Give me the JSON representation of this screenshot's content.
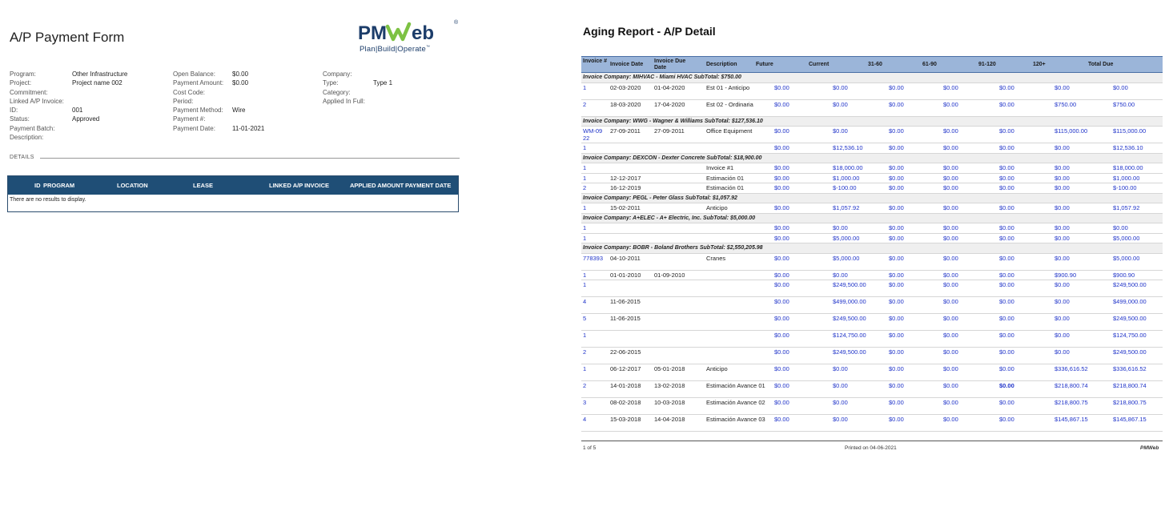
{
  "form": {
    "title": "A/P Payment Form",
    "logo": {
      "word": "PMWeb",
      "registered": "®",
      "tagline": "Plan|Build|Operate",
      "trademark": "™",
      "colors": {
        "navy": "#1c3d6a",
        "green": "#7dc243"
      }
    },
    "fields_col1": [
      {
        "label": "Program:",
        "value": "Other Infrastructure"
      },
      {
        "label": "Project:",
        "value": "Project name 002"
      },
      {
        "label": "Commitment:",
        "value": ""
      },
      {
        "label": "Linked A/P Invoice:",
        "value": ""
      },
      {
        "label": "ID:",
        "value": "001"
      },
      {
        "label": "Status:",
        "value": "Approved"
      },
      {
        "label": "Payment Batch:",
        "value": ""
      },
      {
        "label": "Description:",
        "value": ""
      }
    ],
    "fields_col2": [
      {
        "label": "Open Balance:",
        "value": "$0.00"
      },
      {
        "label": "Payment Amount:",
        "value": "$0.00"
      },
      {
        "label": "Cost Code:",
        "value": ""
      },
      {
        "label": "Period:",
        "value": ""
      },
      {
        "label": "Payment Method:",
        "value": "Wire"
      },
      {
        "label": "Payment #:",
        "value": ""
      },
      {
        "label": "Payment Date:",
        "value": "11-01-2021"
      }
    ],
    "fields_col3": [
      {
        "label": "Company:",
        "value": ""
      },
      {
        "label": "Type:",
        "value": "Type 1"
      },
      {
        "label": "Category:",
        "value": ""
      },
      {
        "label": "Applied In Full:",
        "value": ""
      }
    ],
    "details_label": "DETAILS",
    "grid_headers": [
      "ID",
      "PROGRAM",
      "LOCATION",
      "LEASE",
      "LINKED A/P INVOICE",
      "APPLIED AMOUNT",
      "PAYMENT DATE"
    ],
    "grid_empty": "There are no results to display.",
    "grid_header_color": "#1f4e76"
  },
  "report": {
    "title": "Aging Report - A/P Detail",
    "headers": {
      "invoice": "Invoice #",
      "invoice_date": "Invoice Date",
      "invoice_due": "Invoice Due Date",
      "description": "Description",
      "future": "Future",
      "current": "Current",
      "d31": "31-60",
      "d61": "61-90",
      "d91": "91-120",
      "d120": "120+",
      "total": "Total Due"
    },
    "header_color": "#9bb5d9",
    "link_color": "#1f33c9",
    "groups": [
      {
        "title": "Invoice Company: MIHVAC - Miami HVAC   SubTotal: $750.00",
        "rows": [
          {
            "inv": "1",
            "idate": "02-03-2020",
            "ddate": "01-04-2020",
            "desc": "Est 01 - Anticipo",
            "fut": "$0.00",
            "cur": "$0.00",
            "d31": "$0.00",
            "d61": "$0.00",
            "d91": "$0.00",
            "d120": "$0.00",
            "tot": "$0.00"
          },
          {
            "inv": "2",
            "idate": "18-03-2020",
            "ddate": "17-04-2020",
            "desc": "Est 02 - Ordinaria",
            "fut": "$0.00",
            "cur": "$0.00",
            "d31": "$0.00",
            "d61": "$0.00",
            "d91": "$0.00",
            "d120": "$750.00",
            "tot": "$750.00"
          }
        ]
      },
      {
        "title": "Invoice Company: WWG - Wagner & Williams   SubTotal: $127,536.10",
        "rows": [
          {
            "inv": "WM-0922",
            "idate": "27-09-2011",
            "ddate": "27-09-2011",
            "desc": "Office Equipment",
            "fut": "$0.00",
            "cur": "$0.00",
            "d31": "$0.00",
            "d61": "$0.00",
            "d91": "$0.00",
            "d120": "$115,000.00",
            "tot": "$115,000.00"
          },
          {
            "inv": "1",
            "idate": "",
            "ddate": "",
            "desc": "",
            "fut": "$0.00",
            "cur": "$12,536.10",
            "d31": "$0.00",
            "d61": "$0.00",
            "d91": "$0.00",
            "d120": "$0.00",
            "tot": "$12,536.10"
          }
        ]
      },
      {
        "title": "Invoice Company: DEXCON - Dexter Concrete   SubTotal: $18,900.00",
        "rows": [
          {
            "inv": "1",
            "idate": "",
            "ddate": "",
            "desc": "Invoice #1",
            "fut": "$0.00",
            "cur": "$18,000.00",
            "d31": "$0.00",
            "d61": "$0.00",
            "d91": "$0.00",
            "d120": "$0.00",
            "tot": "$18,000.00"
          },
          {
            "inv": "1",
            "idate": "12-12-2017",
            "ddate": "",
            "desc": "Estimación 01",
            "fut": "$0.00",
            "cur": "$1,000.00",
            "d31": "$0.00",
            "d61": "$0.00",
            "d91": "$0.00",
            "d120": "$0.00",
            "tot": "$1,000.00"
          },
          {
            "inv": "2",
            "idate": "16-12-2019",
            "ddate": "",
            "desc": "Estimación 01",
            "fut": "$0.00",
            "cur": "$-100.00",
            "d31": "$0.00",
            "d61": "$0.00",
            "d91": "$0.00",
            "d120": "$0.00",
            "tot": "$-100.00"
          }
        ]
      },
      {
        "title": "Invoice Company: PEGL - Peter Glass   SubTotal: $1,057.92",
        "rows": [
          {
            "inv": "1",
            "idate": "15-02-2011",
            "ddate": "",
            "desc": "Anticipo",
            "fut": "$0.00",
            "cur": "$1,057.92",
            "d31": "$0.00",
            "d61": "$0.00",
            "d91": "$0.00",
            "d120": "$0.00",
            "tot": "$1,057.92"
          }
        ]
      },
      {
        "title": "Invoice Company: A+ELEC - A+ Electric, Inc.   SubTotal: $5,000.00",
        "rows": [
          {
            "inv": "1",
            "idate": "",
            "ddate": "",
            "desc": "",
            "fut": "$0.00",
            "cur": "$0.00",
            "d31": "$0.00",
            "d61": "$0.00",
            "d91": "$0.00",
            "d120": "$0.00",
            "tot": "$0.00"
          },
          {
            "inv": "1",
            "idate": "",
            "ddate": "",
            "desc": "",
            "fut": "$0.00",
            "cur": "$5,000.00",
            "d31": "$0.00",
            "d61": "$0.00",
            "d91": "$0.00",
            "d120": "$0.00",
            "tot": "$5,000.00"
          }
        ]
      },
      {
        "title": "Invoice Company: BOBR - Boland Brothers   SubTotal: $2,550,205.98",
        "rows": [
          {
            "inv": "778393",
            "idate": "04-10-2011",
            "ddate": "",
            "desc": "Cranes",
            "fut": "$0.00",
            "cur": "$5,000.00",
            "d31": "$0.00",
            "d61": "$0.00",
            "d91": "$0.00",
            "d120": "$0.00",
            "tot": "$5,000.00"
          },
          {
            "inv": "1",
            "idate": "01-01-2010",
            "ddate": "01-09-2010",
            "desc": "",
            "fut": "$0.00",
            "cur": "$0.00",
            "d31": "$0.00",
            "d61": "$0.00",
            "d91": "$0.00",
            "d120": "$900.90",
            "tot": "$900.90"
          },
          {
            "inv": "1",
            "idate": "",
            "ddate": "",
            "desc": "",
            "fut": "$0.00",
            "cur": "$249,500.00",
            "d31": "$0.00",
            "d61": "$0.00",
            "d91": "$0.00",
            "d120": "$0.00",
            "tot": "$249,500.00"
          },
          {
            "inv": "4",
            "idate": "11-06-2015",
            "ddate": "",
            "desc": "",
            "fut": "$0.00",
            "cur": "$499,000.00",
            "d31": "$0.00",
            "d61": "$0.00",
            "d91": "$0.00",
            "d120": "$0.00",
            "tot": "$499,000.00"
          },
          {
            "inv": "5",
            "idate": "11-06-2015",
            "ddate": "",
            "desc": "",
            "fut": "$0.00",
            "cur": "$249,500.00",
            "d31": "$0.00",
            "d61": "$0.00",
            "d91": "$0.00",
            "d120": "$0.00",
            "tot": "$249,500.00"
          },
          {
            "inv": "1",
            "idate": "",
            "ddate": "",
            "desc": "",
            "fut": "$0.00",
            "cur": "$124,750.00",
            "d31": "$0.00",
            "d61": "$0.00",
            "d91": "$0.00",
            "d120": "$0.00",
            "tot": "$124,750.00"
          },
          {
            "inv": "2",
            "idate": "22-06-2015",
            "ddate": "",
            "desc": "",
            "fut": "$0.00",
            "cur": "$249,500.00",
            "d31": "$0.00",
            "d61": "$0.00",
            "d91": "$0.00",
            "d120": "$0.00",
            "tot": "$249,500.00"
          },
          {
            "inv": "1",
            "idate": "06-12-2017",
            "ddate": "05-01-2018",
            "desc": "Anticipo",
            "fut": "$0.00",
            "cur": "$0.00",
            "d31": "$0.00",
            "d61": "$0.00",
            "d91": "$0.00",
            "d120": "$336,616.52",
            "tot": "$336,616.52"
          },
          {
            "inv": "2",
            "idate": "14-01-2018",
            "ddate": "13-02-2018",
            "desc": "Estimación Avance 01",
            "fut": "$0.00",
            "cur": "$0.00",
            "d31": "$0.00",
            "d61": "$0.00",
            "d91": "$0.00",
            "d120": "$218,800.74",
            "tot": "$218,800.74",
            "bold91": true
          },
          {
            "inv": "3",
            "idate": "08-02-2018",
            "ddate": "10-03-2018",
            "desc": "Estimación Avance 02",
            "fut": "$0.00",
            "cur": "$0.00",
            "d31": "$0.00",
            "d61": "$0.00",
            "d91": "$0.00",
            "d120": "$218,800.75",
            "tot": "$218,800.75"
          },
          {
            "inv": "4",
            "idate": "15-03-2018",
            "ddate": "14-04-2018",
            "desc": "Estimación Avance 03",
            "fut": "$0.00",
            "cur": "$0.00",
            "d31": "$0.00",
            "d61": "$0.00",
            "d91": "$0.00",
            "d120": "$145,867.15",
            "tot": "$145,867.15"
          }
        ]
      }
    ],
    "footer": {
      "page": "1 of 5",
      "printed": "Printed on 04-06-2021",
      "brand": "PMWeb"
    }
  }
}
